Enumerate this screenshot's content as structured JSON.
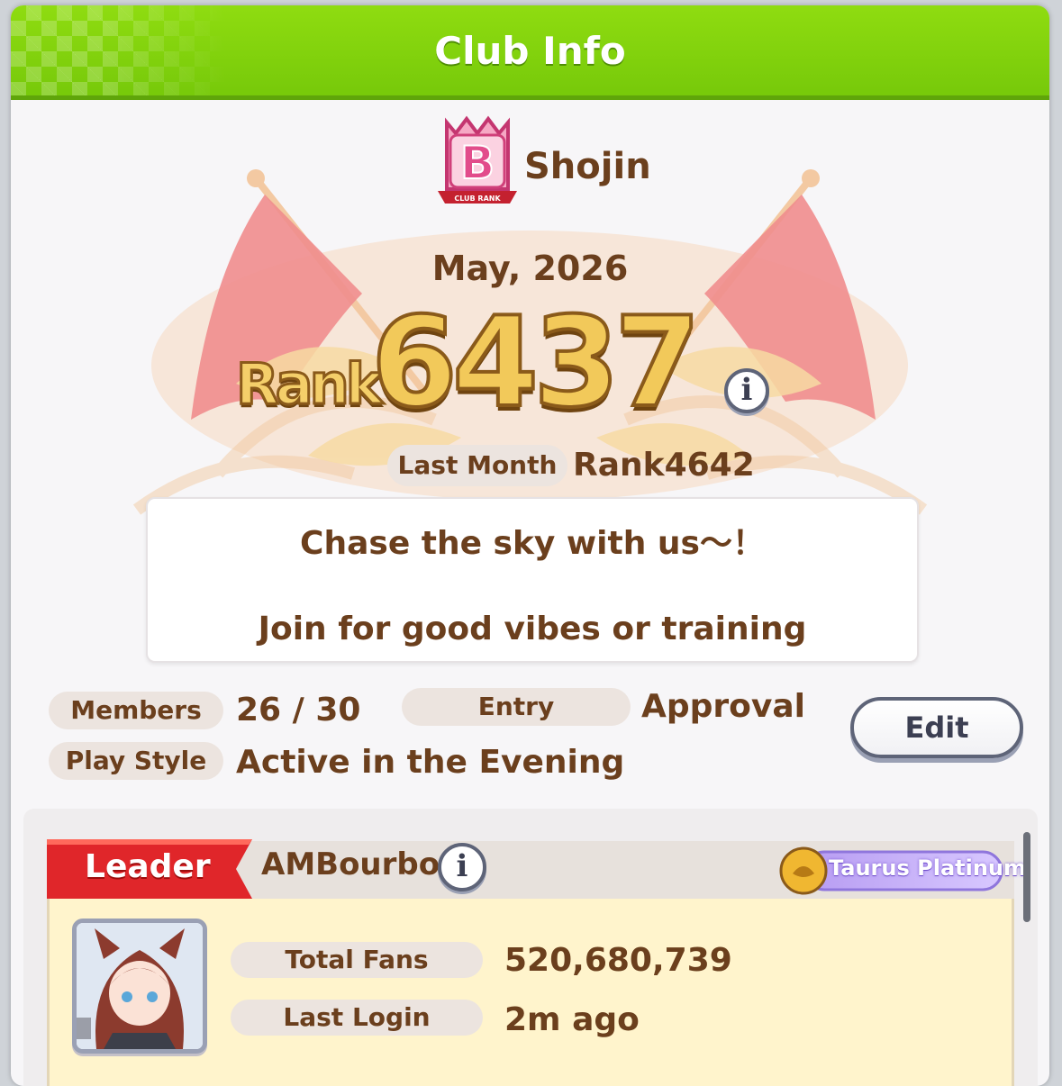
{
  "header": {
    "title": "Club Info"
  },
  "club": {
    "rank_badge_letter": "B",
    "rank_badge_caption": "CLUB RANK",
    "name": "Shojin",
    "month": "May, 2026",
    "rank_word": "Rank",
    "rank_number": "6437",
    "info_symbol": "i",
    "last_month_label": "Last Month",
    "last_month_value": "Rank4642",
    "motto_line1": "Chase the sky with us～！",
    "motto_line2": "Join for good vibes or training"
  },
  "stats": {
    "members_label": "Members",
    "members_value": "26 / 30",
    "entry_label": "Entry",
    "entry_value": "Approval",
    "playstyle_label": "Play Style",
    "playstyle_value": "Active in the Evening",
    "edit_label": "Edit"
  },
  "member": {
    "role": "Leader",
    "name": "AMBourbon",
    "info_symbol": "i",
    "title_badge": "Taurus Platinum",
    "total_fans_label": "Total Fans",
    "total_fans_value": "520,680,739",
    "last_login_label": "Last Login",
    "last_login_value": "2m ago"
  },
  "colors": {
    "header_green": "#83d40e",
    "text_brown": "#6b3f1d",
    "rank_gold": "#f2c95a",
    "leader_red": "#e0262a",
    "card_yellow": "#fff4cc"
  }
}
